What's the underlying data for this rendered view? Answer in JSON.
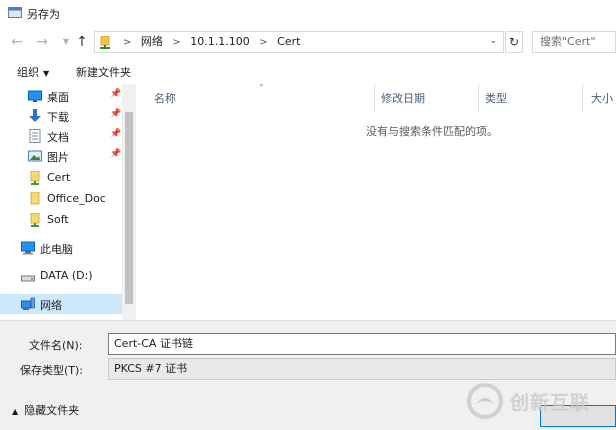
{
  "window": {
    "title": "另存为",
    "app_icon": "save-dialog-icon"
  },
  "nav": {
    "back_icon": "arrow-left-icon",
    "forward_icon": "arrow-right-icon",
    "recent_icon": "chevron-down-icon",
    "up_icon": "arrow-up-icon",
    "breadcrumb": [
      "网络",
      "10.1.1.100",
      "Cert"
    ],
    "refresh_icon": "refresh-icon",
    "search_placeholder": "搜索\"Cert\""
  },
  "toolbar": {
    "organize_label": "组织",
    "new_folder_label": "新建文件夹"
  },
  "sidebar": {
    "items": [
      {
        "label": "桌面",
        "icon": "desktop-icon",
        "pinned": true
      },
      {
        "label": "下载",
        "icon": "download-icon",
        "pinned": true
      },
      {
        "label": "文档",
        "icon": "document-icon",
        "pinned": true
      },
      {
        "label": "图片",
        "icon": "pictures-icon",
        "pinned": true
      },
      {
        "label": "Cert",
        "icon": "folder-icon",
        "pinned": false
      },
      {
        "label": "Office_Doc",
        "icon": "folder-icon",
        "pinned": false
      },
      {
        "label": "Soft",
        "icon": "folder-icon",
        "pinned": false
      },
      {
        "label": "此电脑",
        "icon": "computer-icon",
        "pinned": false
      },
      {
        "label": "DATA (D:)",
        "icon": "drive-icon",
        "pinned": false
      },
      {
        "label": "网络",
        "icon": "network-icon",
        "pinned": false,
        "selected": true
      }
    ]
  },
  "file_list": {
    "columns": [
      "名称",
      "修改日期",
      "类型",
      "大小"
    ],
    "empty_message": "没有与搜索条件匹配的项。"
  },
  "form": {
    "filename_label": "文件名(N):",
    "filename_value": "Cert-CA 证书链",
    "filetype_label": "保存类型(T):",
    "filetype_value": "PKCS #7 证书",
    "hide_folders_label": "隐藏文件夹"
  },
  "watermark": {
    "text": "创新互联",
    "icon": "watermark-logo-icon"
  },
  "colors": {
    "selection": "#cce8ff",
    "accent": "#0078d7",
    "folder": "#f8d775",
    "footer_bg": "#f0f0f0"
  }
}
